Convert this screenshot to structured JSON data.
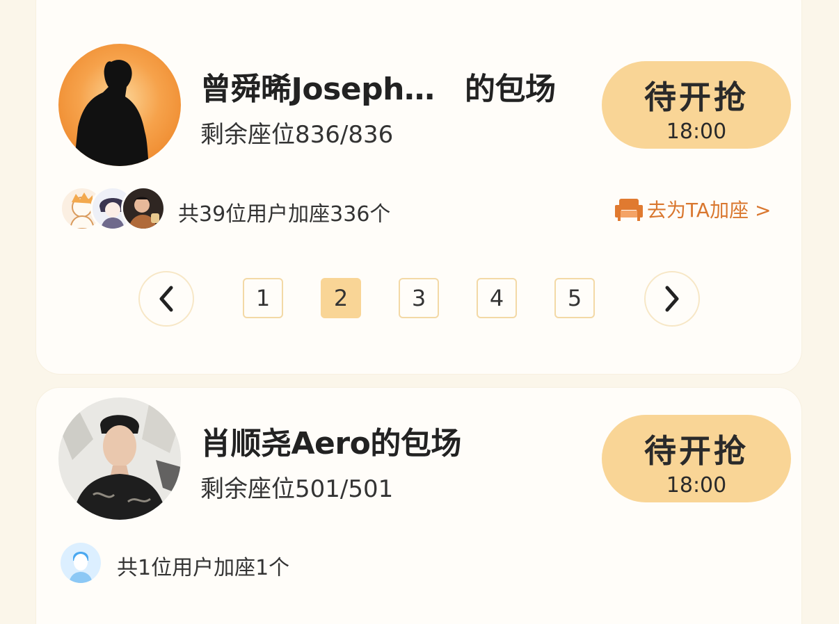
{
  "sessions": [
    {
      "title": "曾舜晞Joseph…　的包场",
      "seats": "剩余座位836/836",
      "button_label": "待开抢",
      "button_time": "18:00",
      "users_summary": "共39位用户加座336个",
      "join_link": "去为TA加座 >",
      "avatar_icon": "silhouette-avatar",
      "pagination": {
        "pages": [
          "1",
          "2",
          "3",
          "4",
          "5"
        ],
        "current": "2"
      }
    },
    {
      "title": "肖顺尧Aero的包场",
      "seats": "剩余座位501/501",
      "button_label": "待开抢",
      "button_time": "18:00",
      "users_summary": "共1位用户加座1个",
      "avatar_icon": "portrait-avatar"
    }
  ],
  "colors": {
    "page_bg": "#fbf6ea",
    "card_bg": "#fffdf9",
    "button": "#f9d596",
    "link": "#d9772f",
    "page_border": "#f3d9a6"
  }
}
